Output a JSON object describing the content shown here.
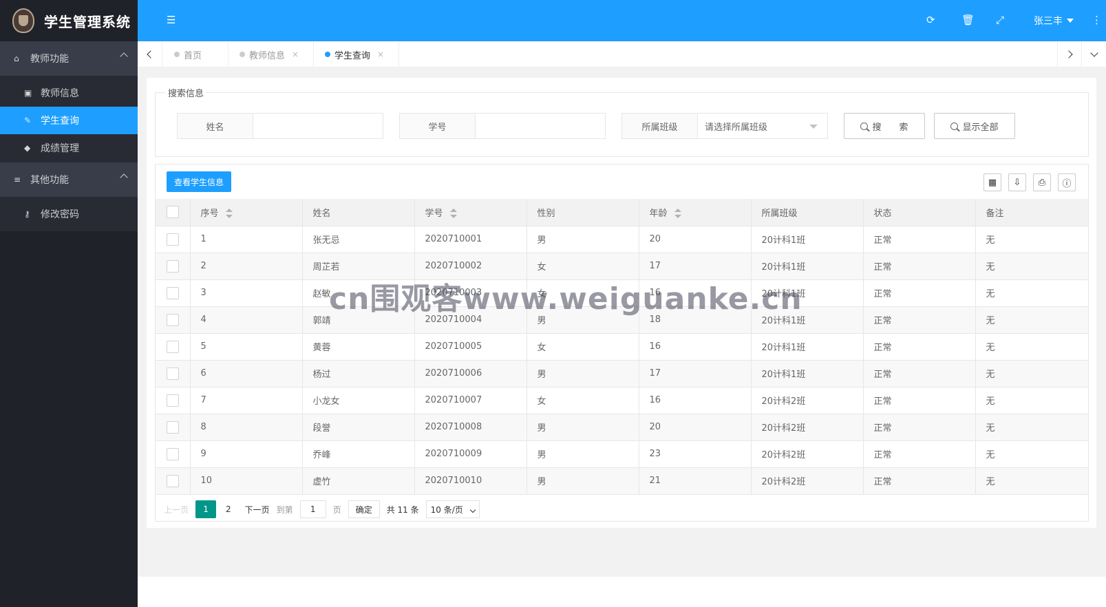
{
  "app": {
    "title": "学生管理系统"
  },
  "sidebar": {
    "groups": [
      {
        "label": "教师功能",
        "items": [
          {
            "label": "教师信息"
          },
          {
            "label": "学生查询"
          },
          {
            "label": "成绩管理"
          }
        ]
      },
      {
        "label": "其他功能",
        "items": [
          {
            "label": "修改密码"
          }
        ]
      }
    ]
  },
  "header": {
    "user": "张三丰"
  },
  "tabs": [
    {
      "label": "首页"
    },
    {
      "label": "教师信息",
      "close": "×"
    },
    {
      "label": "学生查询",
      "close": "×"
    }
  ],
  "search": {
    "legend": "搜索信息",
    "name_label": "姓名",
    "name_value": "",
    "id_label": "学号",
    "id_value": "",
    "class_label": "所属班级",
    "class_placeholder": "请选择所属班级",
    "search_btn": "搜　　索",
    "show_all_btn": "显示全部"
  },
  "table": {
    "toolbar_btn": "查看学生信息",
    "headers": [
      "序号",
      "姓名",
      "学号",
      "性别",
      "年龄",
      "所属班级",
      "状态",
      "备注"
    ],
    "rows": [
      [
        "1",
        "张无忌",
        "2020710001",
        "男",
        "20",
        "20计科1班",
        "正常",
        "无"
      ],
      [
        "2",
        "周芷若",
        "2020710002",
        "女",
        "17",
        "20计科1班",
        "正常",
        "无"
      ],
      [
        "3",
        "赵敏",
        "2020710003",
        "女",
        "16",
        "20计科1班",
        "正常",
        "无"
      ],
      [
        "4",
        "郭靖",
        "2020710004",
        "男",
        "18",
        "20计科1班",
        "正常",
        "无"
      ],
      [
        "5",
        "黄蓉",
        "2020710005",
        "女",
        "16",
        "20计科1班",
        "正常",
        "无"
      ],
      [
        "6",
        "杨过",
        "2020710006",
        "男",
        "17",
        "20计科1班",
        "正常",
        "无"
      ],
      [
        "7",
        "小龙女",
        "2020710007",
        "女",
        "16",
        "20计科2班",
        "正常",
        "无"
      ],
      [
        "8",
        "段誉",
        "2020710008",
        "男",
        "20",
        "20计科2班",
        "正常",
        "无"
      ],
      [
        "9",
        "乔峰",
        "2020710009",
        "男",
        "23",
        "20计科2班",
        "正常",
        "无"
      ],
      [
        "10",
        "虚竹",
        "2020710010",
        "男",
        "21",
        "20计科2班",
        "正常",
        "无"
      ]
    ]
  },
  "pager": {
    "prev": "上一页",
    "pages": [
      "1",
      "2"
    ],
    "next": "下一页",
    "goto": "到第",
    "goto_value": "1",
    "page_unit": "页",
    "confirm": "确定",
    "total": "共 11 条",
    "page_size": "10 条/页"
  },
  "watermark": "cn围观客www.weiguanke.cn"
}
